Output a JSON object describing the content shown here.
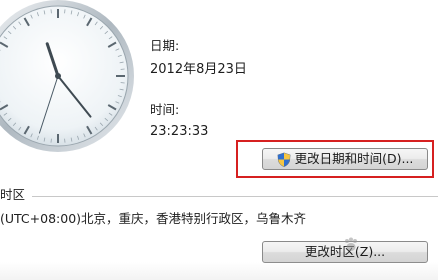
{
  "date_section": {
    "label": "日期:",
    "value": "2012年8月23日"
  },
  "time_section": {
    "label": "时间:",
    "value": "23:23:33"
  },
  "change_datetime_button": {
    "label": "更改日期和时间(D)..."
  },
  "timezone_section": {
    "title": "时区",
    "value": "(UTC+08:00)北京，重庆，香港特别行政区，乌鲁木齐",
    "change_button_label": "更改时区(Z)..."
  },
  "clock": {
    "hours": 23,
    "minutes": 23,
    "seconds": 33
  },
  "colors": {
    "highlight": "#d62020",
    "divider": "#c8c8c8"
  },
  "icons": {
    "uac_shield": "shield-icon",
    "watermark": "paw-icon"
  }
}
